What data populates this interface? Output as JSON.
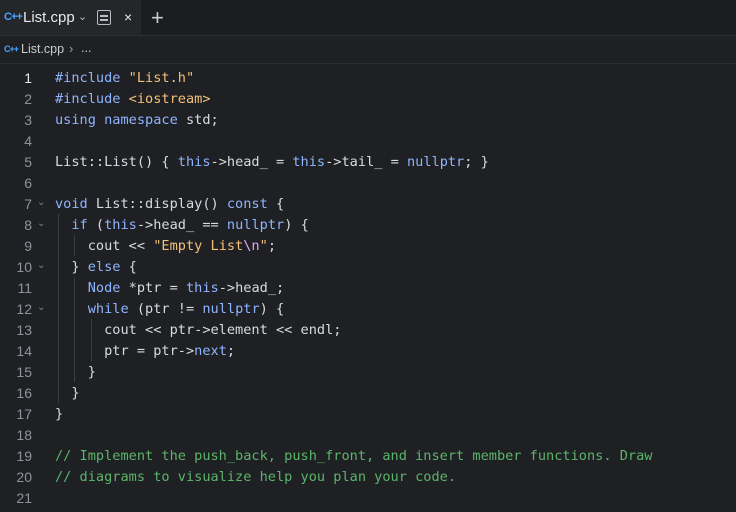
{
  "tab": {
    "icon_text": "C++",
    "title": "List.cpp",
    "chevron": "⌄",
    "close": "×",
    "add": "+"
  },
  "breadcrumb": {
    "icon_text": "C++",
    "file": "List.cpp",
    "separator": "›",
    "more": "..."
  },
  "editor": {
    "active_line": 1,
    "lines": [
      {
        "num": "1",
        "fold": "",
        "tokens": [
          [
            "pp",
            "#include "
          ],
          [
            "str",
            "\"List.h\""
          ]
        ]
      },
      {
        "num": "2",
        "fold": "",
        "tokens": [
          [
            "pp",
            "#include "
          ],
          [
            "str",
            "<iostream>"
          ]
        ]
      },
      {
        "num": "3",
        "fold": "",
        "tokens": [
          [
            "kw",
            "using namespace "
          ],
          [
            "t",
            "std;"
          ]
        ]
      },
      {
        "num": "4",
        "fold": "",
        "tokens": []
      },
      {
        "num": "5",
        "fold": "",
        "tokens": [
          [
            "t",
            "List::List() { "
          ],
          [
            "kw",
            "this"
          ],
          [
            "t",
            "->head_ = "
          ],
          [
            "kw",
            "this"
          ],
          [
            "t",
            "->tail_ = "
          ],
          [
            "kw",
            "nullptr"
          ],
          [
            "t",
            "; }"
          ]
        ]
      },
      {
        "num": "6",
        "fold": "",
        "tokens": []
      },
      {
        "num": "7",
        "fold": "⌄",
        "tokens": [
          [
            "kw",
            "void "
          ],
          [
            "t",
            "List::display() "
          ],
          [
            "kw",
            "const"
          ],
          [
            "t",
            " {"
          ]
        ]
      },
      {
        "num": "8",
        "fold": "⌄",
        "tokens": [
          [
            "t",
            "  "
          ],
          [
            "kw",
            "if"
          ],
          [
            "t",
            " ("
          ],
          [
            "kw",
            "this"
          ],
          [
            "t",
            "->head_ == "
          ],
          [
            "kw",
            "nullptr"
          ],
          [
            "t",
            ") {"
          ]
        ]
      },
      {
        "num": "9",
        "fold": "",
        "tokens": [
          [
            "t",
            "    cout << "
          ],
          [
            "str",
            "\"Empty List"
          ],
          [
            "esc",
            "\\n"
          ],
          [
            "str",
            "\""
          ],
          [
            "t",
            ";"
          ]
        ]
      },
      {
        "num": "10",
        "fold": "⌄",
        "tokens": [
          [
            "t",
            "  } "
          ],
          [
            "kw",
            "else"
          ],
          [
            "t",
            " {"
          ]
        ]
      },
      {
        "num": "11",
        "fold": "",
        "tokens": [
          [
            "t",
            "    "
          ],
          [
            "kw",
            "Node"
          ],
          [
            "t",
            " *ptr = "
          ],
          [
            "kw",
            "this"
          ],
          [
            "t",
            "->head_;"
          ]
        ]
      },
      {
        "num": "12",
        "fold": "⌄",
        "tokens": [
          [
            "t",
            "    "
          ],
          [
            "kw",
            "while"
          ],
          [
            "t",
            " (ptr != "
          ],
          [
            "kw",
            "nullptr"
          ],
          [
            "t",
            ") {"
          ]
        ]
      },
      {
        "num": "13",
        "fold": "",
        "tokens": [
          [
            "t",
            "      cout << ptr->element << endl;"
          ]
        ]
      },
      {
        "num": "14",
        "fold": "",
        "tokens": [
          [
            "t",
            "      ptr = ptr->"
          ],
          [
            "kw",
            "next"
          ],
          [
            "t",
            ";"
          ]
        ]
      },
      {
        "num": "15",
        "fold": "",
        "tokens": [
          [
            "t",
            "    }"
          ]
        ]
      },
      {
        "num": "16",
        "fold": "",
        "tokens": [
          [
            "t",
            "  }"
          ]
        ]
      },
      {
        "num": "17",
        "fold": "",
        "tokens": [
          [
            "t",
            "}"
          ]
        ]
      },
      {
        "num": "18",
        "fold": "",
        "tokens": []
      },
      {
        "num": "19",
        "fold": "",
        "tokens": [
          [
            "cmt",
            "// Implement the push_back, push_front, and insert member functions. Draw"
          ]
        ]
      },
      {
        "num": "20",
        "fold": "",
        "tokens": [
          [
            "cmt",
            "// diagrams to visualize help you plan your code."
          ]
        ]
      },
      {
        "num": "21",
        "fold": "",
        "tokens": []
      }
    ]
  },
  "colors": {
    "background": "#1f2023",
    "keyword": "#8fb4ff",
    "string": "#f2c07a",
    "escape": "#e9a0ff",
    "comment": "#5bb56a",
    "file_icon": "#4aa3ff"
  }
}
